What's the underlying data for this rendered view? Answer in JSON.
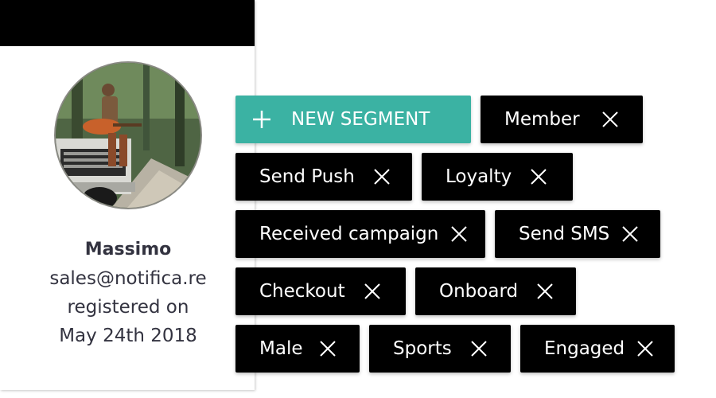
{
  "colors": {
    "header": "#000000",
    "accent": "#3bb2a3",
    "chip_background": "#000000",
    "chip_text": "#ffffff",
    "profile_text": "#333340"
  },
  "profile": {
    "avatar_icon": "user-photo-avatar",
    "name": "Massimo",
    "email": "sales@notifica.re",
    "registered_label": "registered on",
    "registered_date": "May 24th 2018"
  },
  "actions": {
    "new_segment_label": "NEW SEGMENT",
    "new_segment_icon": "plus-icon"
  },
  "segments": [
    {
      "label": "Member",
      "remove_icon": "close-icon"
    },
    {
      "label": "Send Push",
      "remove_icon": "close-icon"
    },
    {
      "label": "Loyalty",
      "remove_icon": "close-icon"
    },
    {
      "label": "Received campaign",
      "remove_icon": "close-icon"
    },
    {
      "label": "Send SMS",
      "remove_icon": "close-icon"
    },
    {
      "label": "Checkout",
      "remove_icon": "close-icon"
    },
    {
      "label": "Onboard",
      "remove_icon": "close-icon"
    },
    {
      "label": "Male",
      "remove_icon": "close-icon"
    },
    {
      "label": "Sports",
      "remove_icon": "close-icon"
    },
    {
      "label": "Engaged",
      "remove_icon": "close-icon"
    }
  ]
}
